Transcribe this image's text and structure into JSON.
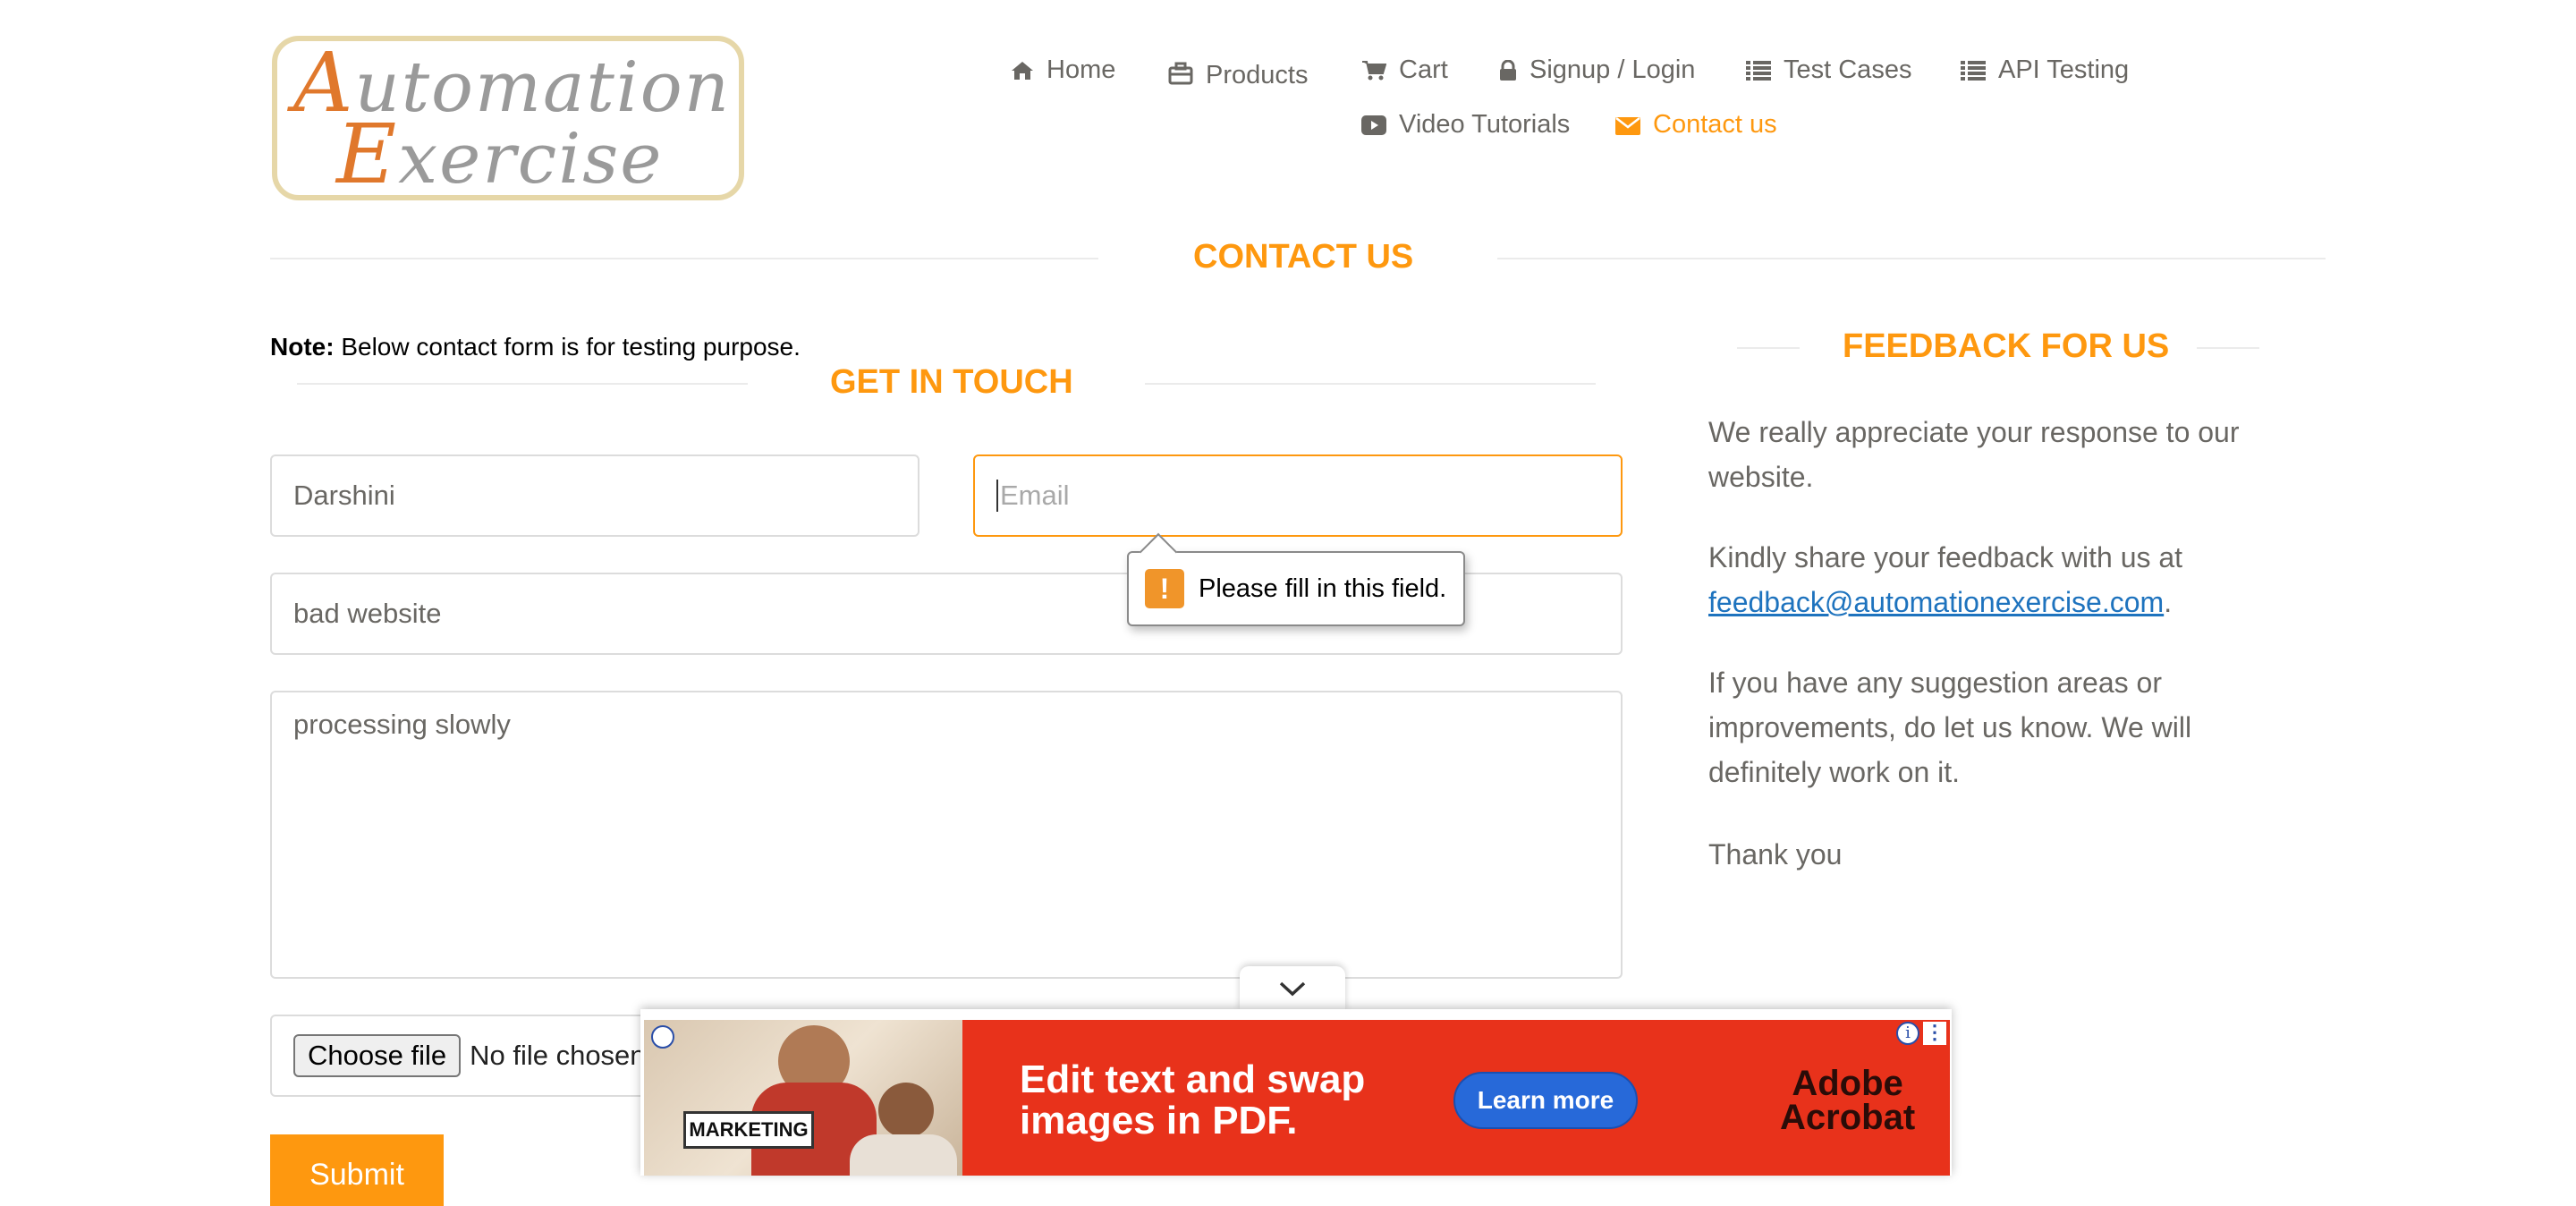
{
  "logo": {
    "line1": "Automation",
    "line2": "Exercise"
  },
  "nav": {
    "home": "Home",
    "products": "Products",
    "cart": "Cart",
    "signup": "Signup / Login",
    "test_cases": "Test Cases",
    "api_testing": "API Testing",
    "video_tutorials": "Video Tutorials",
    "contact_us": "Contact us"
  },
  "page_title": "CONTACT US",
  "note": {
    "label": "Note:",
    "text": " Below contact form is for testing purpose."
  },
  "form": {
    "heading": "GET IN TOUCH",
    "name_value": "Darshini",
    "email_placeholder": "Email",
    "subject_value": "bad website",
    "message_value": "processing slowly",
    "choose_file_label": "Choose file",
    "no_file_text": "No file chosen",
    "submit_label": "Submit",
    "validation_message": "Please fill in this field."
  },
  "feedback": {
    "heading": "FEEDBACK FOR US",
    "p1": "We really appreciate your response to our website.",
    "p2_prefix": "Kindly share your feedback with us at",
    "email_link": "feedback@automationexercise.com",
    "p2_suffix": ".",
    "p3": "If you have any suggestion areas or improvements, do let us know. We will definitely work on it.",
    "p4": "Thank you"
  },
  "ad": {
    "headline": "Edit text and swap\nimages in PDF.",
    "cta": "Learn more",
    "brand": "Adobe\nAcrobat",
    "tag": "MARKETING"
  },
  "colors": {
    "accent": "#FE980F",
    "text": "#696763",
    "link": "#1e73be",
    "ad_red": "#e8321b"
  }
}
